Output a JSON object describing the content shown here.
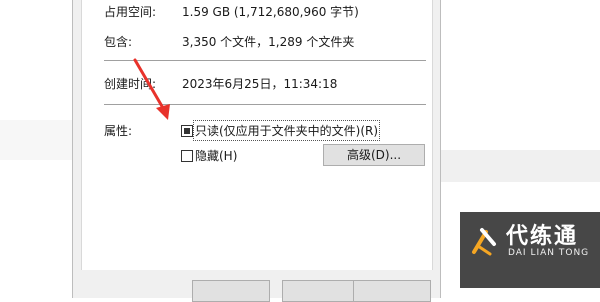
{
  "properties": {
    "size_on_disk_label": "占用空间:",
    "size_on_disk_value": "1.59 GB (1,712,680,960 字节)",
    "contains_label": "包含:",
    "contains_value": "3,350 个文件，1,289 个文件夹",
    "created_label": "创建时间:",
    "created_value": "2023年6月25日，11:34:18",
    "attributes_label": "属性:",
    "readonly_label": "只读(仅应用于文件夹中的文件)(R)",
    "readonly_state": "indeterminate",
    "hidden_label": "隐藏(H)",
    "hidden_checked": false,
    "advanced_button": "高级(D)..."
  },
  "annotation": {
    "arrow_color": "#e8322b"
  },
  "watermark": {
    "title": "代练通",
    "subtitle": "DAI LIAN TONG",
    "accent_color": "#f5a623"
  }
}
